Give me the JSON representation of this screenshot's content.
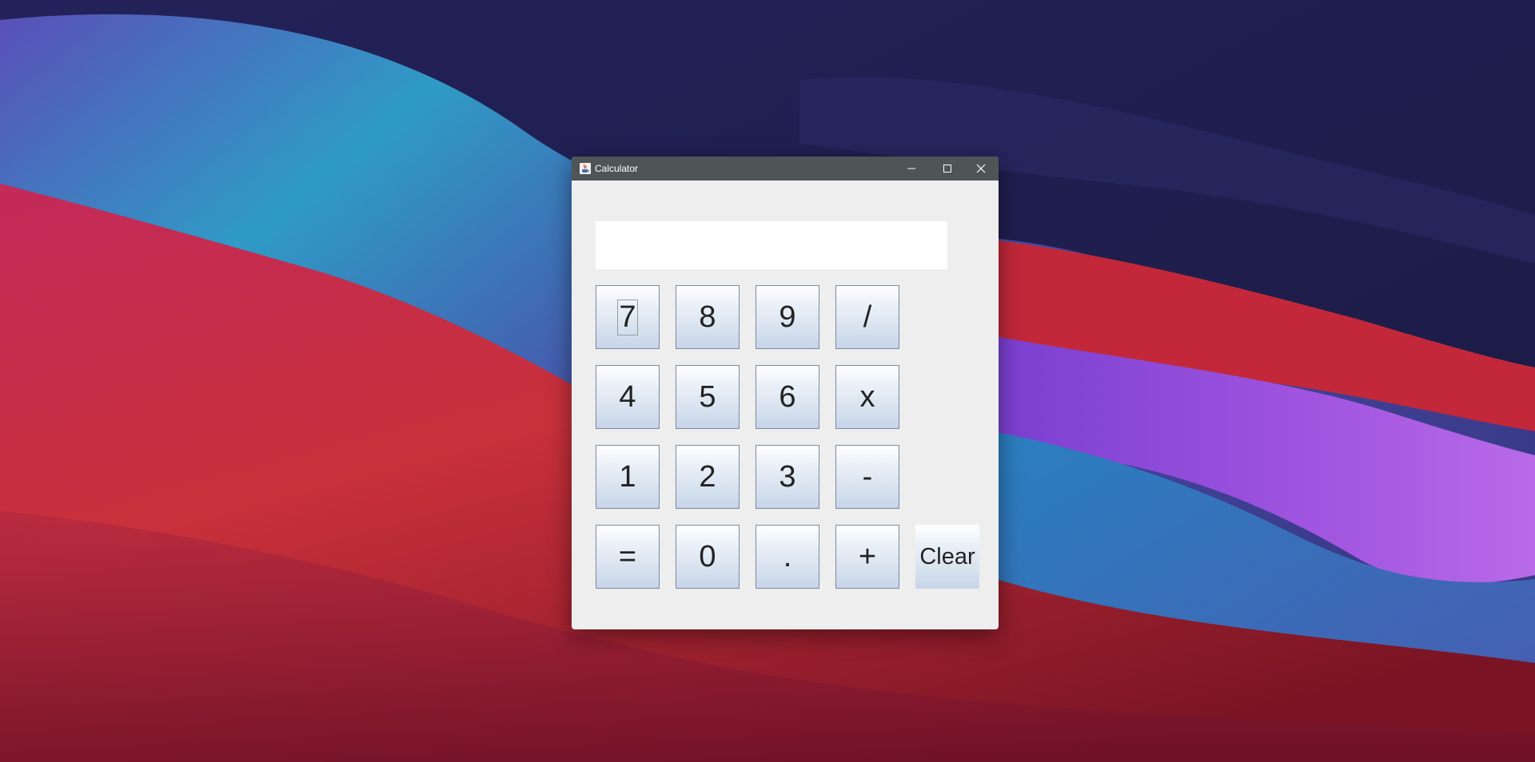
{
  "window": {
    "title": "Calculator",
    "icon": "java-coffee-icon"
  },
  "display": {
    "value": ""
  },
  "keys": {
    "k7": "7",
    "k8": "8",
    "k9": "9",
    "div": "/",
    "k4": "4",
    "k5": "5",
    "k6": "6",
    "mul": "x",
    "k1": "1",
    "k2": "2",
    "k3": "3",
    "sub": "-",
    "eq": "=",
    "k0": "0",
    "dot": ".",
    "add": "+",
    "clear": "Clear"
  },
  "colors": {
    "titlebar": "#4f5556",
    "window_bg": "#eeeeee",
    "key_gradient_bottom": "#c6d6e8",
    "key_border": "#7a8aa0"
  }
}
